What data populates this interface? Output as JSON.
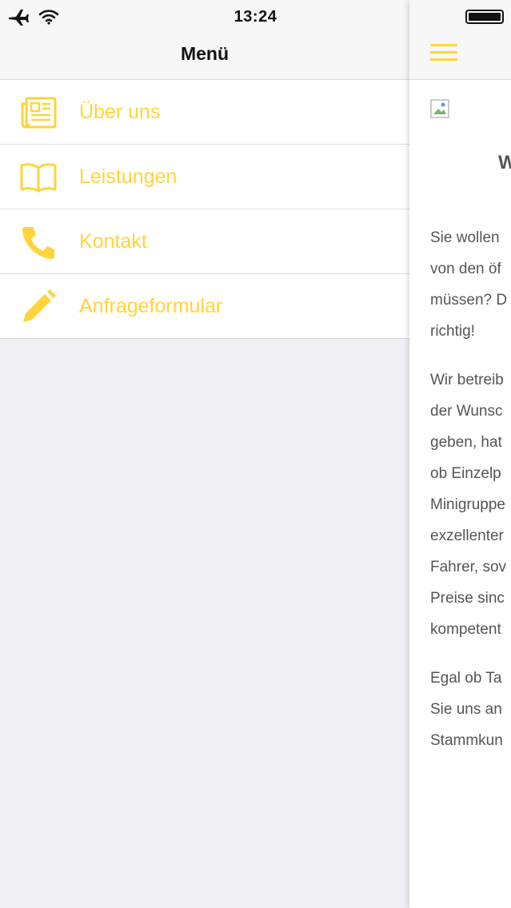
{
  "status_bar": {
    "time": "13:24",
    "icons": [
      "airplane-icon",
      "wifi-icon",
      "battery-icon"
    ]
  },
  "menu": {
    "title": "Menü",
    "items": [
      {
        "label": "Über uns",
        "icon": "newspaper-icon"
      },
      {
        "label": "Leistungen",
        "icon": "book-icon"
      },
      {
        "label": "Kontakt",
        "icon": "phone-icon"
      },
      {
        "label": "Anfrageformular",
        "icon": "pencil-icon"
      }
    ]
  },
  "content": {
    "nav_icon": "hamburger-icon",
    "heading_visible": "W",
    "paragraphs": [
      [
        "Sie wollen",
        "von den öf",
        "müssen? D",
        "richtig!"
      ],
      [
        "Wir betreib",
        "der Wunsc",
        "geben, hat",
        "ob Einzelp",
        "Minigruppe",
        "exzellenter",
        "Fahrer, sov",
        "Preise sinc",
        "kompetent"
      ],
      [
        "Egal ob Ta",
        "Sie uns an",
        "Stammkun"
      ]
    ]
  },
  "colors": {
    "accent": "#ffd43a",
    "background": "#efeff4",
    "header": "#f7f7f7",
    "text": "#555555"
  }
}
